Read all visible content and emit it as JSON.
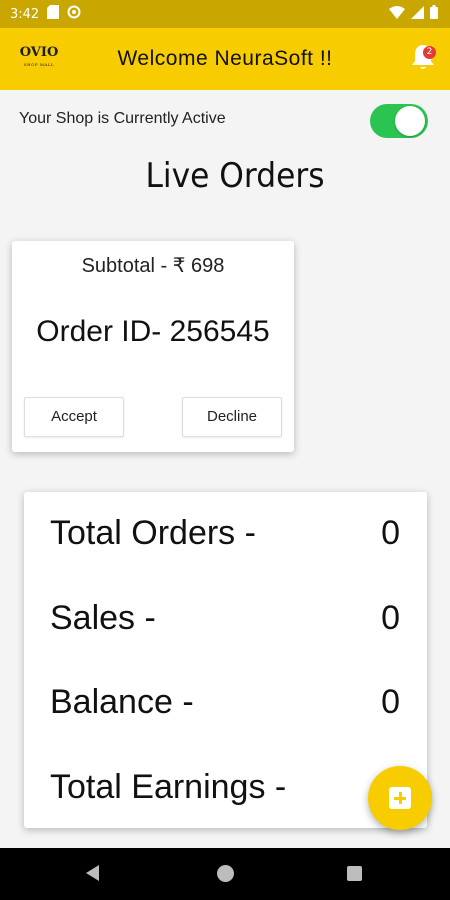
{
  "status_bar": {
    "time": "3:42",
    "icons": [
      "sd-card-icon",
      "sync-icon",
      "wifi-icon",
      "cell-signal-icon",
      "battery-icon"
    ]
  },
  "app_bar": {
    "logo_text": "OVIO",
    "logo_subtext": "SHOP MALL",
    "welcome": "Welcome NeuraSoft !!",
    "notification_count": "2",
    "background_color": "#f7cc00"
  },
  "shop": {
    "status_text": "Your Shop is Currently Active",
    "active": true,
    "toggle_color": "#2bc451"
  },
  "live_orders": {
    "title": "Live Orders",
    "order": {
      "subtotal": "Subtotal - ₹ 698",
      "order_id": "Order ID- 256545",
      "accept_label": "Accept",
      "decline_label": "Decline"
    }
  },
  "stats": {
    "rows": [
      {
        "label": "Total Orders -",
        "value": "0"
      },
      {
        "label": "Sales -",
        "value": "0"
      },
      {
        "label": "Balance -",
        "value": "0"
      },
      {
        "label": "Total Earnings -",
        "value": ""
      }
    ]
  },
  "fab": {
    "icon": "add-box-icon"
  },
  "nav_bar": {
    "icons": [
      "back-icon",
      "home-icon",
      "recents-icon"
    ]
  }
}
